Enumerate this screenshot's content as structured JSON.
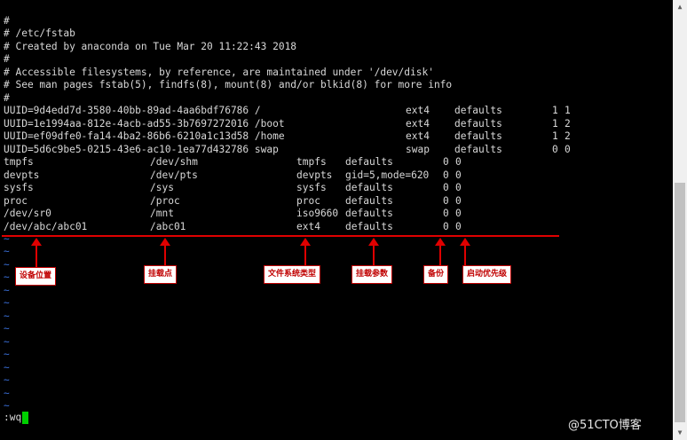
{
  "header_lines": [
    "#",
    "# /etc/fstab",
    "# Created by anaconda on Tue Mar 20 11:22:43 2018",
    "#",
    "# Accessible filesystems, by reference, are maintained under '/dev/disk'",
    "# See man pages fstab(5), findfs(8), mount(8) and/or blkid(8) for more info",
    "#"
  ],
  "uuid_entries": [
    {
      "spec": "UUID=9d4edd7d-3580-40bb-89ad-4aa6bdf76786 /",
      "type": "ext4",
      "options": "defaults",
      "dump": "1",
      "pass": "1"
    },
    {
      "spec": "UUID=1e1994aa-812e-4acb-ad55-3b7697272016 /boot",
      "type": "ext4",
      "options": "defaults",
      "dump": "1",
      "pass": "2"
    },
    {
      "spec": "UUID=ef09dfe0-fa14-4ba2-86b6-6210a1c13d58 /home",
      "type": "ext4",
      "options": "defaults",
      "dump": "1",
      "pass": "2"
    },
    {
      "spec": "UUID=5d6c9be5-0215-43e6-ac10-1ea77d432786 swap",
      "type": "swap",
      "options": "defaults",
      "dump": "0",
      "pass": "0"
    }
  ],
  "entries": [
    {
      "device": "tmpfs",
      "mount": "/dev/shm",
      "type": "tmpfs",
      "options": "defaults",
      "dump": "0",
      "pass": "0"
    },
    {
      "device": "devpts",
      "mount": "/dev/pts",
      "type": "devpts",
      "options": "gid=5,mode=620",
      "dump": "0",
      "pass": "0"
    },
    {
      "device": "sysfs",
      "mount": "/sys",
      "type": "sysfs",
      "options": "defaults",
      "dump": "0",
      "pass": "0"
    },
    {
      "device": "proc",
      "mount": "/proc",
      "type": "proc",
      "options": "defaults",
      "dump": "0",
      "pass": "0"
    },
    {
      "device": "/dev/sr0",
      "mount": "/mnt",
      "type": "iso9660",
      "options": "defaults",
      "dump": "0",
      "pass": "0"
    },
    {
      "device": "/dev/abc/abc01",
      "mount": "/abc01",
      "type": "ext4",
      "options": "defaults",
      "dump": "0",
      "pass": "0"
    }
  ],
  "tilde_char": "~",
  "tilde_count": 14,
  "annotations": [
    {
      "key": "device",
      "label": "设备位置"
    },
    {
      "key": "mount",
      "label": "挂载点"
    },
    {
      "key": "fstype",
      "label": "文件系统类型"
    },
    {
      "key": "options",
      "label": "挂载参数"
    },
    {
      "key": "dump",
      "label": "备份"
    },
    {
      "key": "pass",
      "label": "启动优先级"
    }
  ],
  "command_line": ":wq",
  "watermark": "@51CTO博客",
  "colors": {
    "background": "#000000",
    "text": "#d8d8d8",
    "tilde": "#3a6fd8",
    "annotation": "#c00000",
    "cursor": "#00d000"
  },
  "scrollbar_position": 0.47
}
